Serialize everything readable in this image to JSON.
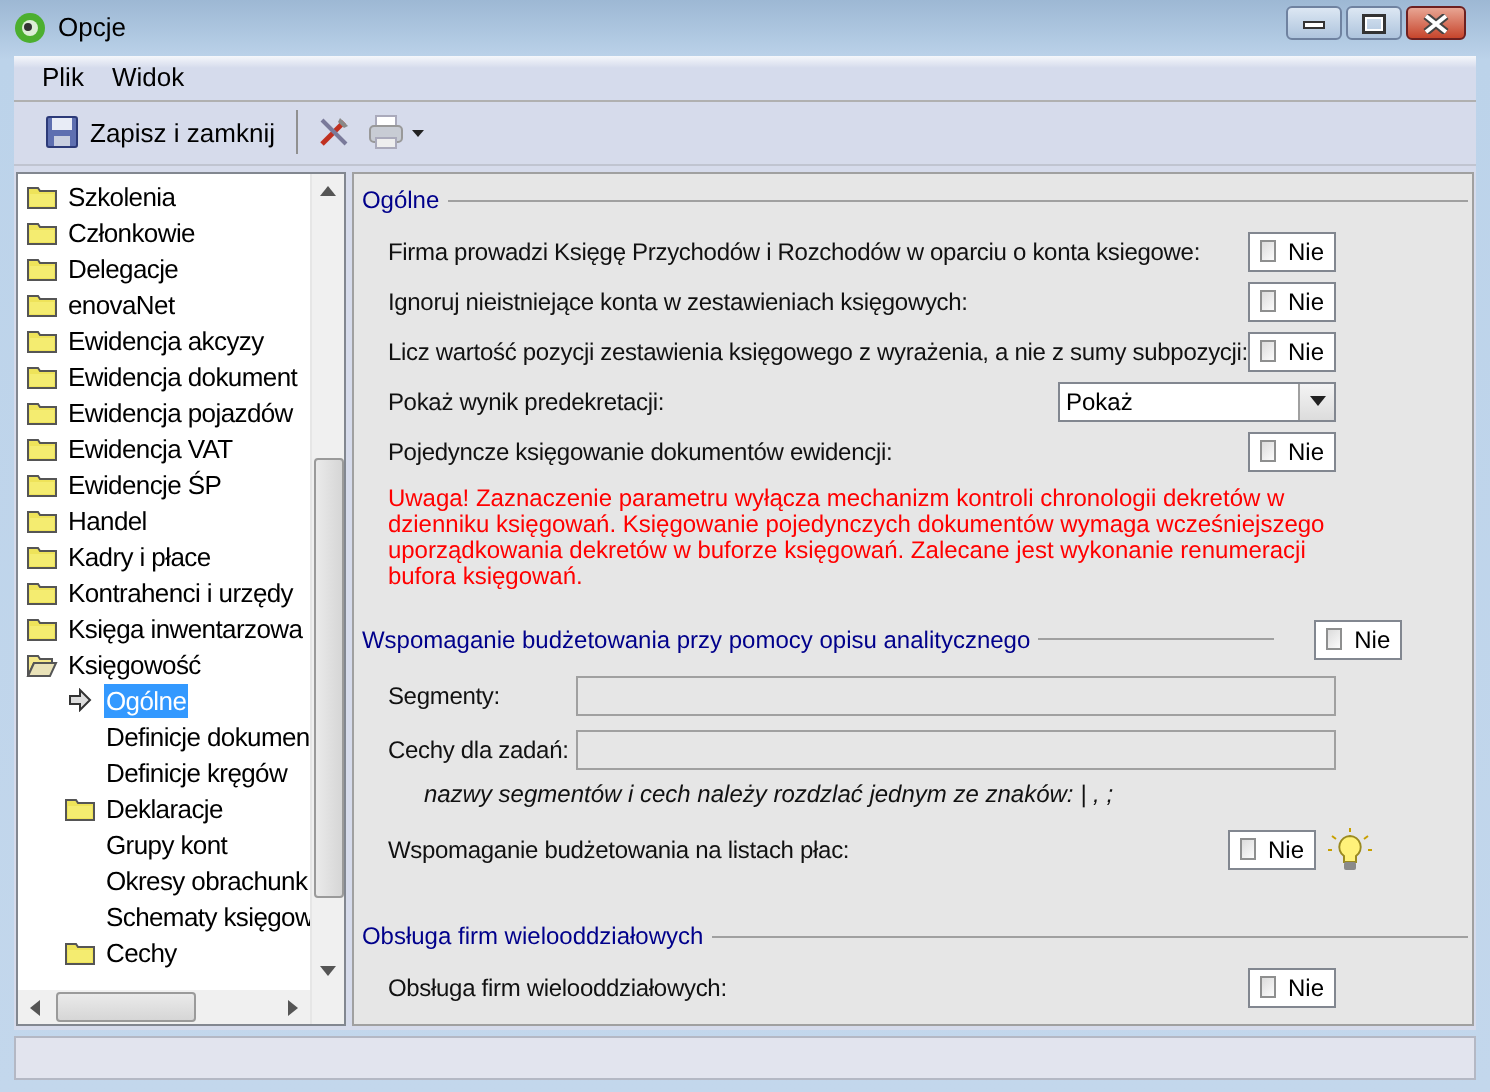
{
  "window": {
    "title": "Opcje"
  },
  "menu": [
    {
      "label": "Plik"
    },
    {
      "label": "Widok"
    }
  ],
  "toolbar": {
    "save_label": "Zapisz i zamknij"
  },
  "tree": {
    "items": [
      {
        "label": "Szkolenia",
        "kind": "folder",
        "expanded": false,
        "selected": false
      },
      {
        "label": "Członkowie",
        "kind": "folder",
        "expanded": false,
        "selected": false
      },
      {
        "label": "Delegacje",
        "kind": "folder",
        "expanded": false,
        "selected": false
      },
      {
        "label": "enovaNet",
        "kind": "folder",
        "expanded": false,
        "selected": false
      },
      {
        "label": "Ewidencja akcyzy",
        "kind": "folder",
        "expanded": false,
        "selected": false
      },
      {
        "label": "Ewidencja dokument",
        "kind": "folder",
        "expanded": false,
        "selected": false
      },
      {
        "label": "Ewidencja pojazdów",
        "kind": "folder",
        "expanded": false,
        "selected": false
      },
      {
        "label": "Ewidencja VAT",
        "kind": "folder",
        "expanded": false,
        "selected": false
      },
      {
        "label": "Ewidencje ŚP",
        "kind": "folder",
        "expanded": false,
        "selected": false
      },
      {
        "label": "Handel",
        "kind": "folder",
        "expanded": false,
        "selected": false
      },
      {
        "label": "Kadry i płace",
        "kind": "folder",
        "expanded": false,
        "selected": false
      },
      {
        "label": "Kontrahenci i urzędy",
        "kind": "folder",
        "expanded": false,
        "selected": false
      },
      {
        "label": "Księga inwentarzowa",
        "kind": "folder",
        "expanded": false,
        "selected": false
      },
      {
        "label": "Księgowość",
        "kind": "folder",
        "expanded": true,
        "selected": false,
        "children": [
          {
            "label": "Ogólne",
            "kind": "page",
            "selected": true
          },
          {
            "label": "Definicje dokumen",
            "kind": "page",
            "selected": false
          },
          {
            "label": "Definicje kręgów",
            "kind": "page",
            "selected": false
          },
          {
            "label": "Deklaracje",
            "kind": "folder",
            "expanded": false,
            "selected": false
          },
          {
            "label": "Grupy kont",
            "kind": "page",
            "selected": false
          },
          {
            "label": "Okresy obrachunk",
            "kind": "page",
            "selected": false
          },
          {
            "label": "Schematy księgow",
            "kind": "page",
            "selected": false
          },
          {
            "label": "Cechy",
            "kind": "folder",
            "expanded": false,
            "selected": false
          }
        ]
      }
    ]
  },
  "sections": [
    {
      "title": "Ogólne",
      "rows": [
        {
          "kind": "check",
          "label": "Firma prowadzi Księgę Przychodów i Rozchodów w oparciu o konta ksiegowe:",
          "checked": false,
          "value": "Nie"
        },
        {
          "kind": "check",
          "label": "Ignoruj nieistniejące konta w zestawieniach księgowych:",
          "checked": false,
          "value": "Nie"
        },
        {
          "kind": "check",
          "label": "Licz wartość pozycji zestawienia księgowego z wyrażenia, a nie z sumy subpozycji:",
          "checked": false,
          "value": "Nie"
        },
        {
          "kind": "select",
          "label": "Pokaż wynik predekretacji:",
          "value": "Pokaż"
        },
        {
          "kind": "check",
          "label": "Pojedyncze księgowanie dokumentów ewidencji:",
          "checked": false,
          "value": "Nie"
        },
        {
          "kind": "warning",
          "text": "Uwaga! Zaznaczenie parametru wyłącza mechanizm kontroli chronologii dekretów w dzienniku księgowań. Księgowanie pojedynczych dokumentów wymaga wcześniejszego uporządkowania dekretów w buforze księgowań. Zalecane jest wykonanie renumeracji bufora księgowań."
        }
      ]
    },
    {
      "title": "Wspomaganie budżetowania przy pomocy opisu analitycznego",
      "header_check": {
        "checked": false,
        "value": "Nie"
      },
      "rows": [
        {
          "kind": "field",
          "label": "Segmenty:",
          "disabled": true
        },
        {
          "kind": "field",
          "label": "Cechy dla zadań:",
          "disabled": true
        },
        {
          "kind": "hint",
          "text": "nazwy segmentów i cech należy rozdzlać jednym ze znaków: | , ;"
        },
        {
          "kind": "check",
          "label": "Wspomaganie budżetowania na listach płac:",
          "checked": false,
          "value": "Nie",
          "tip": true
        }
      ]
    },
    {
      "title": "Obsługa firm wielooddziałowych",
      "rows": [
        {
          "kind": "check",
          "label": "Obsługa firm wielooddziałowych:",
          "checked": false,
          "value": "Nie"
        }
      ]
    }
  ]
}
